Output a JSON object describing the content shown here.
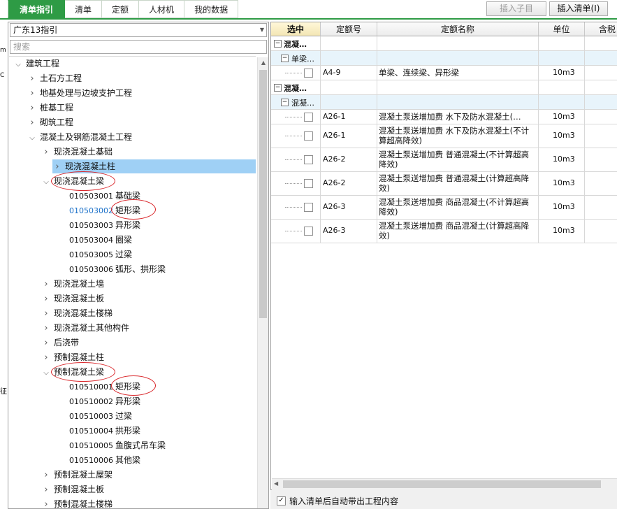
{
  "tabs": [
    "清单指引",
    "清单",
    "定额",
    "人材机",
    "我的数据"
  ],
  "toolbar": {
    "insert_child": "插入子目",
    "insert_list": "插入清单(I)"
  },
  "left_edge": [
    "m",
    "C",
    "征"
  ],
  "left": {
    "combo_value": "广东13指引",
    "search_placeholder": "搜索",
    "tree": [
      {
        "text": "建筑工程",
        "level": 0,
        "toggle": "open"
      },
      {
        "text": "土石方工程",
        "level": 1,
        "toggle": "closed"
      },
      {
        "text": "地基处理与边坡支护工程",
        "level": 1,
        "toggle": "closed"
      },
      {
        "text": "桩基工程",
        "level": 1,
        "toggle": "closed"
      },
      {
        "text": "砌筑工程",
        "level": 1,
        "toggle": "closed"
      },
      {
        "text": "混凝土及钢筋混凝土工程",
        "level": 1,
        "toggle": "open"
      },
      {
        "text": "现浇混凝土基础",
        "level": 2,
        "toggle": "closed"
      },
      {
        "text": "现浇混凝土柱",
        "level": 2,
        "toggle": "closed",
        "selected": true
      },
      {
        "text": "现浇混凝土梁",
        "level": 2,
        "toggle": "open",
        "ring": true
      },
      {
        "code": "010503001",
        "text": "基础梁",
        "level": 3
      },
      {
        "code": "010503002",
        "text": "矩形梁",
        "level": 3,
        "link": true,
        "ring": true
      },
      {
        "code": "010503003",
        "text": "异形梁",
        "level": 3
      },
      {
        "code": "010503004",
        "text": "圈梁",
        "level": 3
      },
      {
        "code": "010503005",
        "text": "过梁",
        "level": 3
      },
      {
        "code": "010503006",
        "text": "弧形、拱形梁",
        "level": 3
      },
      {
        "text": "现浇混凝土墙",
        "level": 2,
        "toggle": "closed"
      },
      {
        "text": "现浇混凝土板",
        "level": 2,
        "toggle": "closed"
      },
      {
        "text": "现浇混凝土楼梯",
        "level": 2,
        "toggle": "closed"
      },
      {
        "text": "现浇混凝土其他构件",
        "level": 2,
        "toggle": "closed"
      },
      {
        "text": "后浇带",
        "level": 2,
        "toggle": "closed"
      },
      {
        "text": "预制混凝土柱",
        "level": 2,
        "toggle": "closed"
      },
      {
        "text": "预制混凝土梁",
        "level": 2,
        "toggle": "open",
        "ring": true
      },
      {
        "code": "010510001",
        "text": "矩形梁",
        "level": 3,
        "ring": true
      },
      {
        "code": "010510002",
        "text": "异形梁",
        "level": 3
      },
      {
        "code": "010510003",
        "text": "过梁",
        "level": 3
      },
      {
        "code": "010510004",
        "text": "拱形梁",
        "level": 3
      },
      {
        "code": "010510005",
        "text": "鱼腹式吊车梁",
        "level": 3
      },
      {
        "code": "010510006",
        "text": "其他梁",
        "level": 3
      },
      {
        "text": "预制混凝土屋架",
        "level": 2,
        "toggle": "closed"
      },
      {
        "text": "预制混凝土板",
        "level": 2,
        "toggle": "closed"
      },
      {
        "text": "预制混凝土楼梯",
        "level": 2,
        "toggle": "closed"
      }
    ]
  },
  "grid": {
    "columns": [
      "选中",
      "定额号",
      "定额名称",
      "单位",
      "含税"
    ],
    "rows": [
      {
        "kind": "group",
        "level": 0,
        "label": "混凝…"
      },
      {
        "kind": "group",
        "level": 1,
        "label": "单梁…"
      },
      {
        "kind": "item",
        "code": "A4-9",
        "name": "单梁、连续梁、异形梁",
        "unit": "10m3"
      },
      {
        "kind": "group",
        "level": 0,
        "label": "混凝…"
      },
      {
        "kind": "group",
        "level": 1,
        "label": "混凝…"
      },
      {
        "kind": "item",
        "code": "A26-1",
        "name": "混凝土泵送增加费 水下及防水混凝土(…",
        "unit": "10m3"
      },
      {
        "kind": "item",
        "code": "A26-1",
        "name": "混凝土泵送增加费 水下及防水混凝土(不计算超高降效)",
        "unit": "10m3",
        "tall": true
      },
      {
        "kind": "item",
        "code": "A26-2",
        "name": "混凝土泵送增加费 普通混凝土(不计算超高降效)",
        "unit": "10m3",
        "tall": true
      },
      {
        "kind": "item",
        "code": "A26-2",
        "name": "混凝土泵送增加费 普通混凝土(计算超高降效)",
        "unit": "10m3",
        "tall": true
      },
      {
        "kind": "item",
        "code": "A26-3",
        "name": "混凝土泵送增加费 商品混凝土(不计算超高降效)",
        "unit": "10m3",
        "tall": true
      },
      {
        "kind": "item",
        "code": "A26-3",
        "name": "混凝土泵送增加费 商品混凝土(计算超高降效)",
        "unit": "10m3",
        "tall": true
      }
    ]
  },
  "footer": {
    "checkbox_label": "输入清单后自动带出工程内容",
    "checked": true
  }
}
